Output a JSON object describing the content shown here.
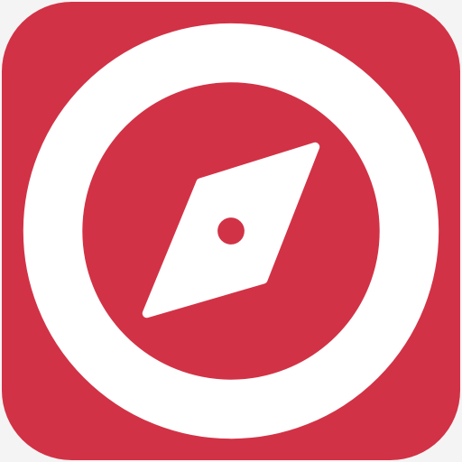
{
  "app_icon": {
    "icon": "compass-icon",
    "colors": {
      "tile": "#d23246",
      "glyph": "#ffffff",
      "page_background": "#f4f4f4"
    }
  }
}
